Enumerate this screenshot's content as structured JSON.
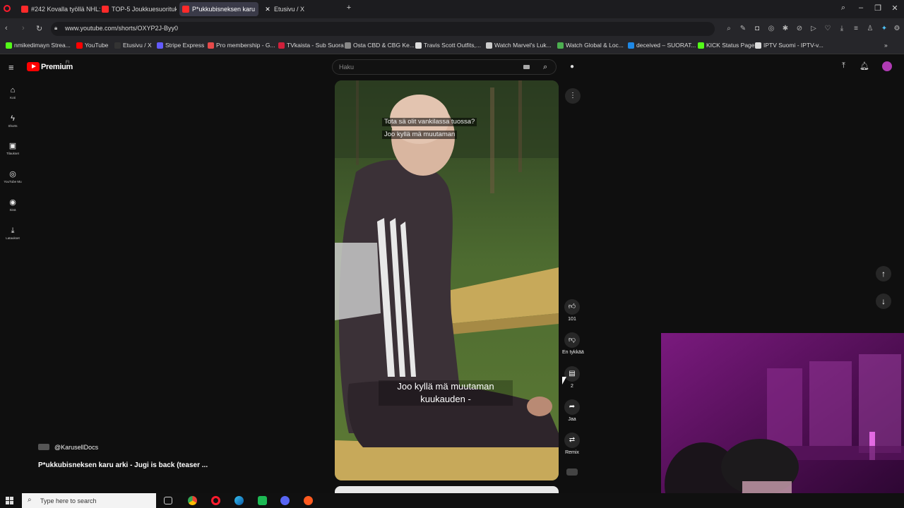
{
  "browser": {
    "tabs": [
      {
        "title": "#242 Kovalla työllä NHL:st",
        "color": "#ff2a2a"
      },
      {
        "title": "TOP-5 Joukkuesuorituks",
        "color": "#ff2a2a"
      },
      {
        "title": "P*ukkubisneksen karu",
        "color": "#ff2a2a"
      },
      {
        "title": "Etusivu / X",
        "color": "#444444"
      }
    ],
    "new_tab": "+",
    "url": "www.youtube.com/shorts/OXYP2J-Byy0",
    "bookmarks": [
      {
        "label": "nmikedimayn Strea...",
        "color": "#53fc18"
      },
      {
        "label": "YouTube",
        "color": "#ff0000"
      },
      {
        "label": "Etusivu / X",
        "color": "#333333"
      },
      {
        "label": "Stripe Express",
        "color": "#635bff"
      },
      {
        "label": "Pro membership - G...",
        "color": "#e64a4a"
      },
      {
        "label": "TVkaista - Sub Suora",
        "color": "#d0203b"
      },
      {
        "label": "Osta CBD & CBG Ke...",
        "color": "#888888"
      },
      {
        "label": "Travis Scott Outfits,...",
        "color": "#dddddd"
      },
      {
        "label": "Watch Marvel's Luk...",
        "color": "#cccccc"
      },
      {
        "label": "Watch Global & Loc...",
        "color": "#4caf50"
      },
      {
        "label": "deceived – SUORAT...",
        "color": "#1e88e5"
      },
      {
        "label": "KICK Status Page",
        "color": "#53fc18"
      },
      {
        "label": "IPTV Suomi - IPTV-v...",
        "color": "#dddddd"
      }
    ]
  },
  "youtube": {
    "logo_text": "Premium",
    "logo_country": "FI",
    "search_placeholder": "Haku",
    "nav": [
      {
        "label": "Koti",
        "icon": "home-icon"
      },
      {
        "label": "Shorts",
        "icon": "shorts-icon"
      },
      {
        "label": "Tilaukset",
        "icon": "subscriptions-icon"
      },
      {
        "label": "YouTube Mu",
        "icon": "music-icon"
      },
      {
        "label": "Sinä",
        "icon": "you-icon"
      },
      {
        "label": "Lataukset",
        "icon": "downloads-icon"
      }
    ],
    "short": {
      "caption_top": [
        "Tota sä olit vankilassa tuossa?",
        "Joo kyllä mä muutaman"
      ],
      "caption_bottom": [
        "Joo kyllä mä muutaman",
        "kuukauden -"
      ],
      "likes": "101",
      "dislike_label": "En tykkää",
      "comments": "2",
      "share_label": "Jaa",
      "remix_label": "Remix"
    },
    "channel": {
      "handle": "@KarusellDocs",
      "title": "P*ukkubisneksen karu arki - Jugi is back (teaser ..."
    }
  },
  "taskbar": {
    "search_placeholder": "Type here to search"
  }
}
